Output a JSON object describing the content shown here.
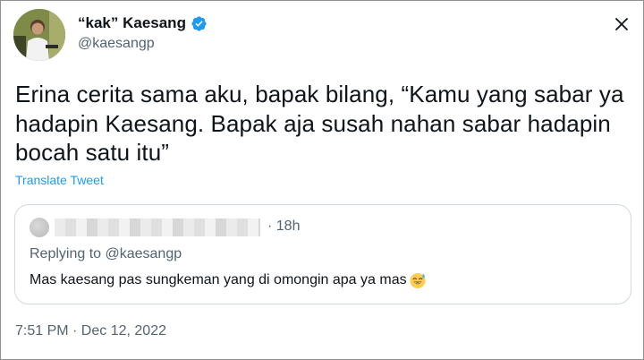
{
  "author": {
    "display_name": "“kak” Kaesang",
    "handle": "@kaesangp",
    "verified": true
  },
  "tweet": {
    "text": "Erina cerita sama aku, bapak bilang, “Kamu yang sabar ya hadapin Kaesang. Bapak aja susah nahan sabar hadapin bocah satu itu”",
    "translate_label": "Translate Tweet",
    "timestamp": "7:51 PM · Dec 12, 2022"
  },
  "quoted_tweet": {
    "time_ago": "· 18h",
    "replying_to": "Replying to @kaesangp",
    "text": "Mas kaesang pas sungkeman yang di omongin apa ya mas",
    "emoji": "sweat-smile-emoji"
  },
  "icons": {
    "verified": "verified-badge-icon",
    "close": "close-icon"
  },
  "colors": {
    "accent": "#1d9bf0",
    "secondary_text": "#536471",
    "primary_text": "#0f1419",
    "border": "#cfd9de"
  }
}
